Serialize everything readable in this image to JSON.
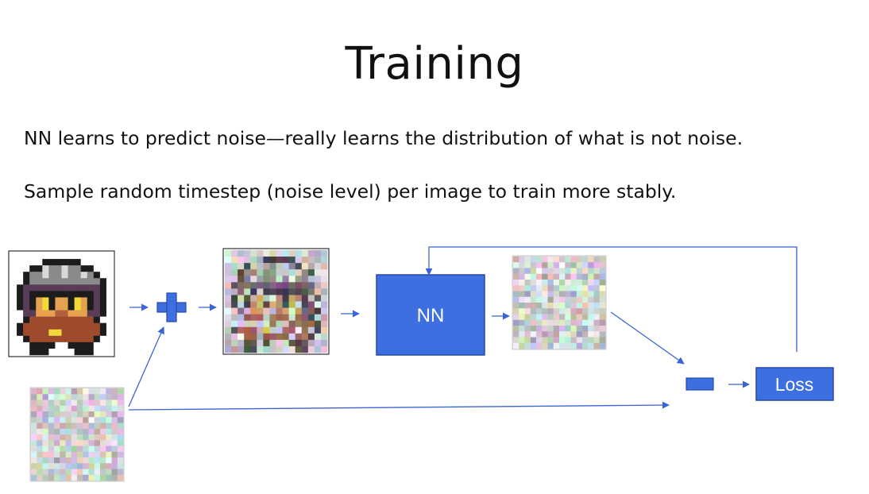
{
  "slide": {
    "title": "Training",
    "bullets": [
      "NN learns to predict noise—really learns the distribution of what is not noise.",
      "Sample random timestep (noise level) per image to train more stably."
    ]
  },
  "diagram": {
    "nn_label": "NN",
    "loss_label": "Loss",
    "accent_color": "#3d6fe0",
    "box_border_color": "#274aa6",
    "arrow_color": "#3b65d6",
    "icons": {
      "plus": "plus-operator-icon",
      "minus": "minus-operator-icon"
    }
  }
}
